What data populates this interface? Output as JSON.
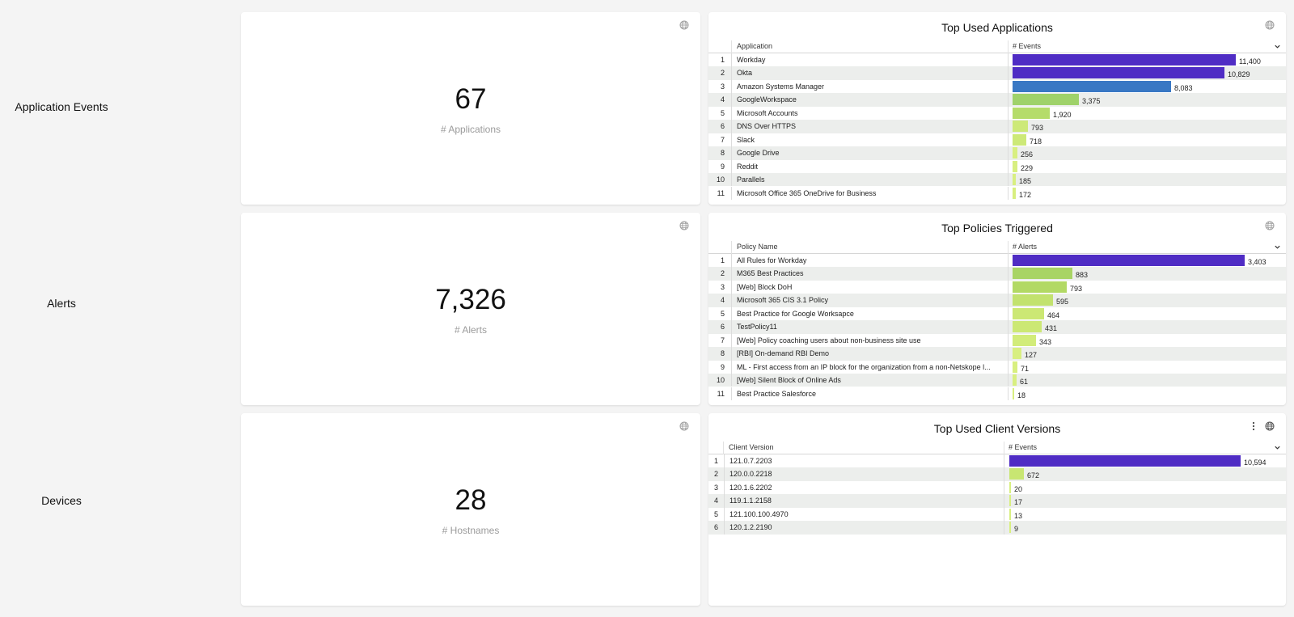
{
  "rows": [
    {
      "label": "Application Events",
      "kpi": {
        "value": "67",
        "label": "# Applications"
      },
      "table": {
        "title": "Top Used Applications",
        "name_header": "Application",
        "metric_header": "# Events",
        "max": 11400,
        "rows": [
          {
            "idx": "1",
            "name": "Workday",
            "value": 11400,
            "value_label": "11,400",
            "color": "#4f2cc4"
          },
          {
            "idx": "2",
            "name": "Okta",
            "value": 10829,
            "value_label": "10,829",
            "color": "#4f2cc4"
          },
          {
            "idx": "3",
            "name": "Amazon Systems Manager",
            "value": 8083,
            "value_label": "8,083",
            "color": "#3978c4"
          },
          {
            "idx": "4",
            "name": "GoogleWorkspace",
            "value": 3375,
            "value_label": "3,375",
            "color": "#9fd26a"
          },
          {
            "idx": "5",
            "name": "Microsoft Accounts",
            "value": 1920,
            "value_label": "1,920",
            "color": "#b5dc6a"
          },
          {
            "idx": "6",
            "name": "DNS Over HTTPS",
            "value": 793,
            "value_label": "793",
            "color": "#cde978"
          },
          {
            "idx": "7",
            "name": "Slack",
            "value": 718,
            "value_label": "718",
            "color": "#cde978"
          },
          {
            "idx": "8",
            "name": "Google Drive",
            "value": 256,
            "value_label": "256",
            "color": "#d8ef80"
          },
          {
            "idx": "9",
            "name": "Reddit",
            "value": 229,
            "value_label": "229",
            "color": "#d8ef80"
          },
          {
            "idx": "10",
            "name": "Parallels",
            "value": 185,
            "value_label": "185",
            "color": "#d8ef80"
          },
          {
            "idx": "11",
            "name": "Microsoft Office 365 OneDrive for Business",
            "value": 172,
            "value_label": "172",
            "color": "#d8ef80"
          }
        ]
      }
    },
    {
      "label": "Alerts",
      "kpi": {
        "value": "7,326",
        "label": "# Alerts"
      },
      "table": {
        "title": "Top Policies Triggered",
        "name_header": "Policy Name",
        "metric_header": "# Alerts",
        "max": 3403,
        "rows": [
          {
            "idx": "1",
            "name": "All Rules for Workday",
            "value": 3403,
            "value_label": "3,403",
            "color": "#4f2cc4"
          },
          {
            "idx": "2",
            "name": "M365 Best Practices",
            "value": 883,
            "value_label": "883",
            "color": "#a8d464"
          },
          {
            "idx": "3",
            "name": "[Web] Block DoH",
            "value": 793,
            "value_label": "793",
            "color": "#b2d964"
          },
          {
            "idx": "4",
            "name": "Microsoft 365 CIS 3.1 Policy",
            "value": 595,
            "value_label": "595",
            "color": "#c2e26e"
          },
          {
            "idx": "5",
            "name": "Best Practice for Google Worksapce",
            "value": 464,
            "value_label": "464",
            "color": "#cce874"
          },
          {
            "idx": "6",
            "name": "TestPolicy11",
            "value": 431,
            "value_label": "431",
            "color": "#cce874"
          },
          {
            "idx": "7",
            "name": "[Web] Policy coaching users about non-business site use",
            "value": 343,
            "value_label": "343",
            "color": "#d2ec7a"
          },
          {
            "idx": "8",
            "name": "[RBI] On-demand RBI Demo",
            "value": 127,
            "value_label": "127",
            "color": "#d8ef80"
          },
          {
            "idx": "9",
            "name": "ML - First access from an IP block for the organization from a non-Netskope l...",
            "value": 71,
            "value_label": "71",
            "color": "#d8ef80"
          },
          {
            "idx": "10",
            "name": "[Web] Silent Block of Online Ads",
            "value": 61,
            "value_label": "61",
            "color": "#d8ef80"
          },
          {
            "idx": "11",
            "name": "Best Practice Salesforce",
            "value": 18,
            "value_label": "18",
            "color": "#d8ef80"
          }
        ]
      }
    },
    {
      "label": "Devices",
      "kpi": {
        "value": "28",
        "label": "# Hostnames"
      },
      "table": {
        "title": "Top Used Client Versions",
        "name_header": "Client Version",
        "metric_header": "# Events",
        "max": 10594,
        "rows": [
          {
            "idx": "1",
            "name": "121.0.7.2203",
            "value": 10594,
            "value_label": "10,594",
            "color": "#4f2cc4"
          },
          {
            "idx": "2",
            "name": "120.0.0.2218",
            "value": 672,
            "value_label": "672",
            "color": "#c8e672"
          },
          {
            "idx": "3",
            "name": "120.1.6.2202",
            "value": 20,
            "value_label": "20",
            "color": "#d8ef80"
          },
          {
            "idx": "4",
            "name": "119.1.1.2158",
            "value": 17,
            "value_label": "17",
            "color": "#d8ef80"
          },
          {
            "idx": "5",
            "name": "121.100.100.4970",
            "value": 13,
            "value_label": "13",
            "color": "#d8ef80"
          },
          {
            "idx": "6",
            "name": "120.1.2.2190",
            "value": 9,
            "value_label": "9",
            "color": "#d8ef80"
          }
        ]
      }
    }
  ],
  "icons": {
    "globe": "globe-icon",
    "kebab": "more-options-icon",
    "sort": "chevron-down-icon"
  }
}
